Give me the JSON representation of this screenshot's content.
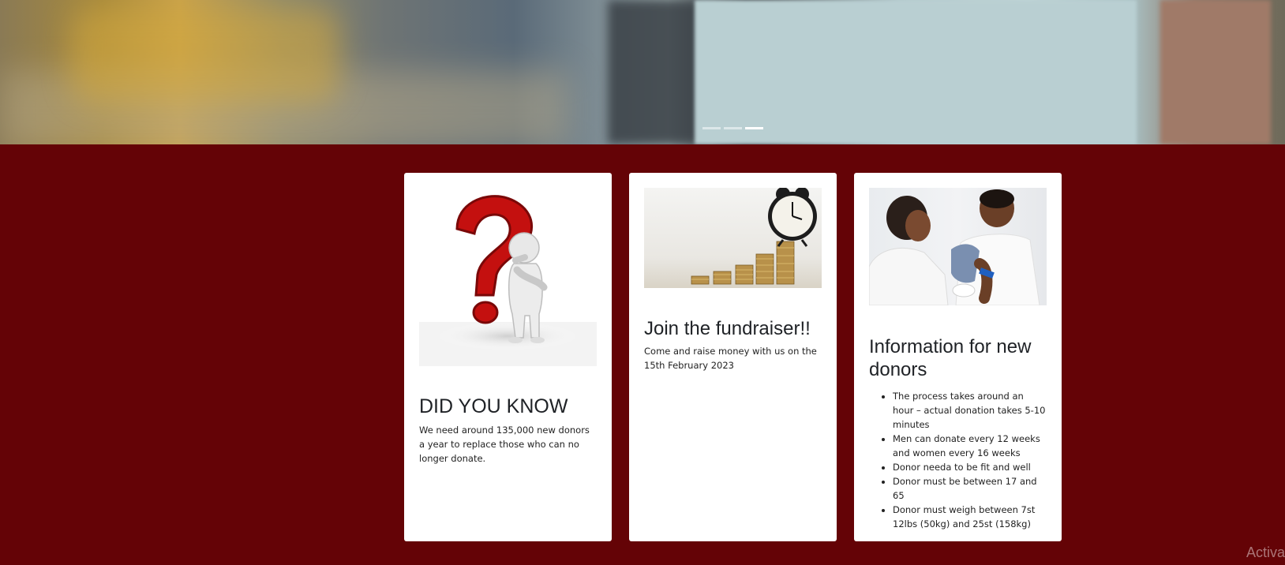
{
  "carousel": {
    "slides": 3,
    "active_index": 2
  },
  "cards": [
    {
      "image": "question-mark-figure-image",
      "title": "DID YOU KNOW",
      "text": "We need around 135,000 new donors a year to replace those who can no longer donate."
    },
    {
      "image": "clock-coins-image",
      "title": "Join the fundraiser!!",
      "text": "Come and raise money with us on the 15th February 2023"
    },
    {
      "image": "blood-donation-image",
      "title": "Information for new donors",
      "items": [
        "The process takes around an hour – actual donation takes 5-10 minutes",
        "Men can donate every 12 weeks and women every 16 weeks",
        "Donor needa to be fit and well",
        "Donor must be between 17 and 65",
        "Donor must weigh between 7st 12lbs (50kg) and 25st (158kg)"
      ]
    }
  ],
  "watermark": "Activa",
  "colors": {
    "background": "#640306",
    "card": "#ffffff",
    "question_mark": "#c4100f"
  }
}
